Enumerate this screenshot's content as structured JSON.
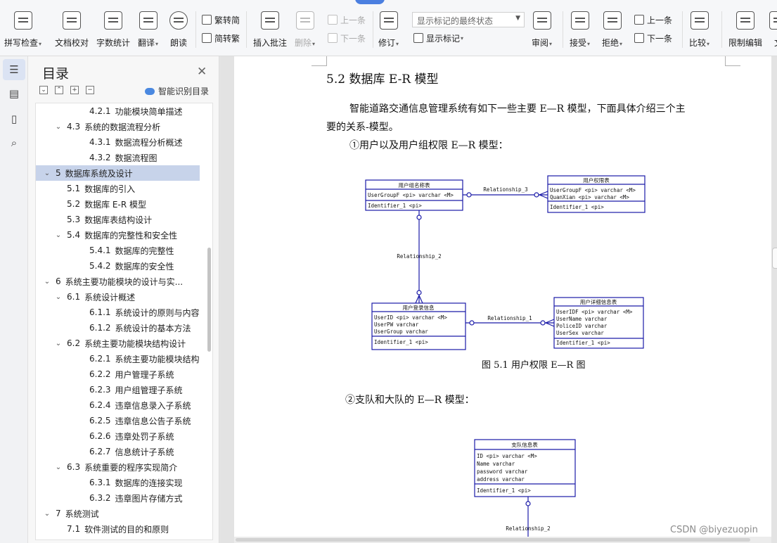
{
  "ribbon": {
    "spell_check": "拼写检查",
    "doc_proof": "文档校对",
    "word_count": "字数统计",
    "translate": "翻译",
    "read_aloud": "朗读",
    "trad_to_simp": "繁转简",
    "simp_to_trad": "简转繁",
    "insert_comment": "插入批注",
    "delete": "删除",
    "prev_comment": "上一条",
    "next_comment": "下一条",
    "track_changes": "修订",
    "markup_mode": "显示标记的最终状态",
    "show_markup": "显示标记",
    "review_pane": "审阅",
    "accept": "接受",
    "reject": "拒绝",
    "prev_change": "上一条",
    "next_change": "下一条",
    "compare": "比较",
    "restrict_edit": "限制编辑",
    "more": "文"
  },
  "toc": {
    "title": "目录",
    "smart_toc": "智能识别目录",
    "items": [
      {
        "level": 3,
        "num": "4.2.1",
        "label": "功能模块简单描述",
        "arrow": ""
      },
      {
        "level": 2,
        "num": "4.3",
        "label": "系统的数据流程分析",
        "arrow": "⌄"
      },
      {
        "level": 3,
        "num": "4.3.1",
        "label": "数据流程分析概述",
        "arrow": ""
      },
      {
        "level": 3,
        "num": "4.3.2",
        "label": "数据流程图",
        "arrow": ""
      },
      {
        "level": 1,
        "num": "5",
        "label": "数据库系统及设计",
        "arrow": "⌄",
        "selected": true
      },
      {
        "level": 2,
        "num": "5.1",
        "label": "数据库的引入",
        "arrow": ""
      },
      {
        "level": 2,
        "num": "5.2",
        "label": "数据库 E-R 模型",
        "arrow": ""
      },
      {
        "level": 2,
        "num": "5.3",
        "label": "数据库表结构设计",
        "arrow": ""
      },
      {
        "level": 2,
        "num": "5.4",
        "label": "数据库的完整性和安全性",
        "arrow": "⌄"
      },
      {
        "level": 3,
        "num": "5.4.1",
        "label": "数据库的完整性",
        "arrow": ""
      },
      {
        "level": 3,
        "num": "5.4.2",
        "label": "数据库的安全性",
        "arrow": ""
      },
      {
        "level": 1,
        "num": "6",
        "label": "系统主要功能模块的设计与实...",
        "arrow": "⌄"
      },
      {
        "level": 2,
        "num": "6.1",
        "label": "系统设计概述",
        "arrow": "⌄"
      },
      {
        "level": 3,
        "num": "6.1.1",
        "label": "系统设计的原则与内容",
        "arrow": ""
      },
      {
        "level": 3,
        "num": "6.1.2",
        "label": "系统设计的基本方法",
        "arrow": ""
      },
      {
        "level": 2,
        "num": "6.2",
        "label": "系统主要功能模块结构设计",
        "arrow": "⌄"
      },
      {
        "level": 3,
        "num": "6.2.1",
        "label": "系统主要功能模块结构",
        "arrow": ""
      },
      {
        "level": 3,
        "num": "6.2.2",
        "label": "用户管理子系统",
        "arrow": ""
      },
      {
        "level": 3,
        "num": "6.2.3",
        "label": "用户组管理子系统",
        "arrow": ""
      },
      {
        "level": 3,
        "num": "6.2.4",
        "label": "违章信息录入子系统",
        "arrow": ""
      },
      {
        "level": 3,
        "num": "6.2.5",
        "label": "违章信息公告子系统",
        "arrow": ""
      },
      {
        "level": 3,
        "num": "6.2.6",
        "label": "违章处罚子系统",
        "arrow": ""
      },
      {
        "level": 3,
        "num": "6.2.7",
        "label": "信息统计子系统",
        "arrow": ""
      },
      {
        "level": 2,
        "num": "6.3",
        "label": "系统重要的程序实现简介",
        "arrow": "⌄"
      },
      {
        "level": 3,
        "num": "6.3.1",
        "label": "数据库的连接实现",
        "arrow": ""
      },
      {
        "level": 3,
        "num": "6.3.2",
        "label": "违章图片存储方式",
        "arrow": ""
      },
      {
        "level": 1,
        "num": "7",
        "label": "系统测试",
        "arrow": "⌄"
      },
      {
        "level": 2,
        "num": "7.1",
        "label": "软件测试的目的和原则",
        "arrow": ""
      }
    ]
  },
  "document": {
    "heading": "5.2  数据库 E-R 模型",
    "para1_line1": "智能道路交通信息管理系统有如下一些主要 E—R 模型，下面具体介绍三个主",
    "para1_line2": "要的关系-模型。",
    "item1": "①用户以及用户组权限 E—R 模型：",
    "caption1": "图 5.1  用户权限 E—R 图",
    "item2": "②支队和大队的 E—R 模型：",
    "watermark": "CSDN @biyezuopin"
  },
  "er1": {
    "entities": [
      {
        "title": "用户组名称表",
        "attrs": [
          "UserGroupF  <pi>  varchar  <M>"
        ],
        "ident": "Identifier_1  <pi>"
      },
      {
        "title": "用户权限表",
        "attrs": [
          "UserGroupF  <pi>  varchar  <M>",
          "QuanXian    <pi>  varchar  <M>"
        ],
        "ident": "Identifier_1  <pi>"
      },
      {
        "title": "用户登录信息",
        "attrs": [
          "UserID     <pi>  varchar  <M>",
          "UserPW           varchar",
          "UserGroup        varchar"
        ],
        "ident": "Identifier_1  <pi>"
      },
      {
        "title": "用户详细信息表",
        "attrs": [
          "UserIDF   <pi>  varchar  <M>",
          "UserName        varchar",
          "PoliceID        varchar",
          "UserSex         varchar"
        ],
        "ident": "Identifier_1  <pi>"
      }
    ],
    "relationships": [
      "Relationship_3",
      "Relationship_2",
      "Relationship_1"
    ]
  },
  "er2": {
    "entity": {
      "title": "支队信息表",
      "attrs": [
        "ID          <pi>  varchar  <M>",
        "Name              varchar",
        "password          varchar",
        "address           varchar"
      ],
      "ident": "Identifier_1  <pi>"
    },
    "relationship": "Relationship_2"
  },
  "colors": {
    "er_line": "#1a1aa8",
    "selected": "#c7d3ea",
    "accent": "#4b7fe0"
  }
}
